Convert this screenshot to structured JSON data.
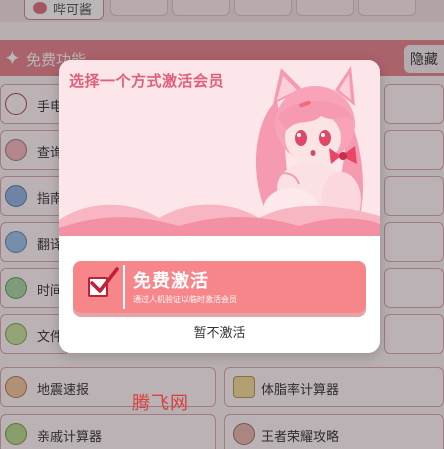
{
  "topbar": {
    "app_name": "哔可酱"
  },
  "section": {
    "title": "免费功能",
    "hide_label": "隐藏"
  },
  "tiles": [
    {
      "label": "手电筒"
    },
    {
      "label": "查询"
    },
    {
      "label": "指南"
    },
    {
      "label": "翻译"
    },
    {
      "label": "时间"
    },
    {
      "label": "文件"
    },
    {
      "label": "地震速报"
    },
    {
      "label": "体脂率计算器"
    },
    {
      "label": "亲戚计算器"
    },
    {
      "label": "王者荣耀攻略"
    }
  ],
  "dialog": {
    "title": "选择一个方式激活会员",
    "activate_title": "免费激活",
    "activate_subtitle": "通过人机验证以临时激活会员",
    "skip_label": "暂不激活"
  },
  "watermark": "腾飞网",
  "colors": {
    "accent": "#f7868b",
    "banner_bg": "#fde6ea",
    "title": "#e0607a",
    "section_bar": "#e8838e"
  },
  "icons": [
    "sparkle-icon",
    "flashlight-icon",
    "checkbox-icon",
    "anime-character-illustration"
  ]
}
